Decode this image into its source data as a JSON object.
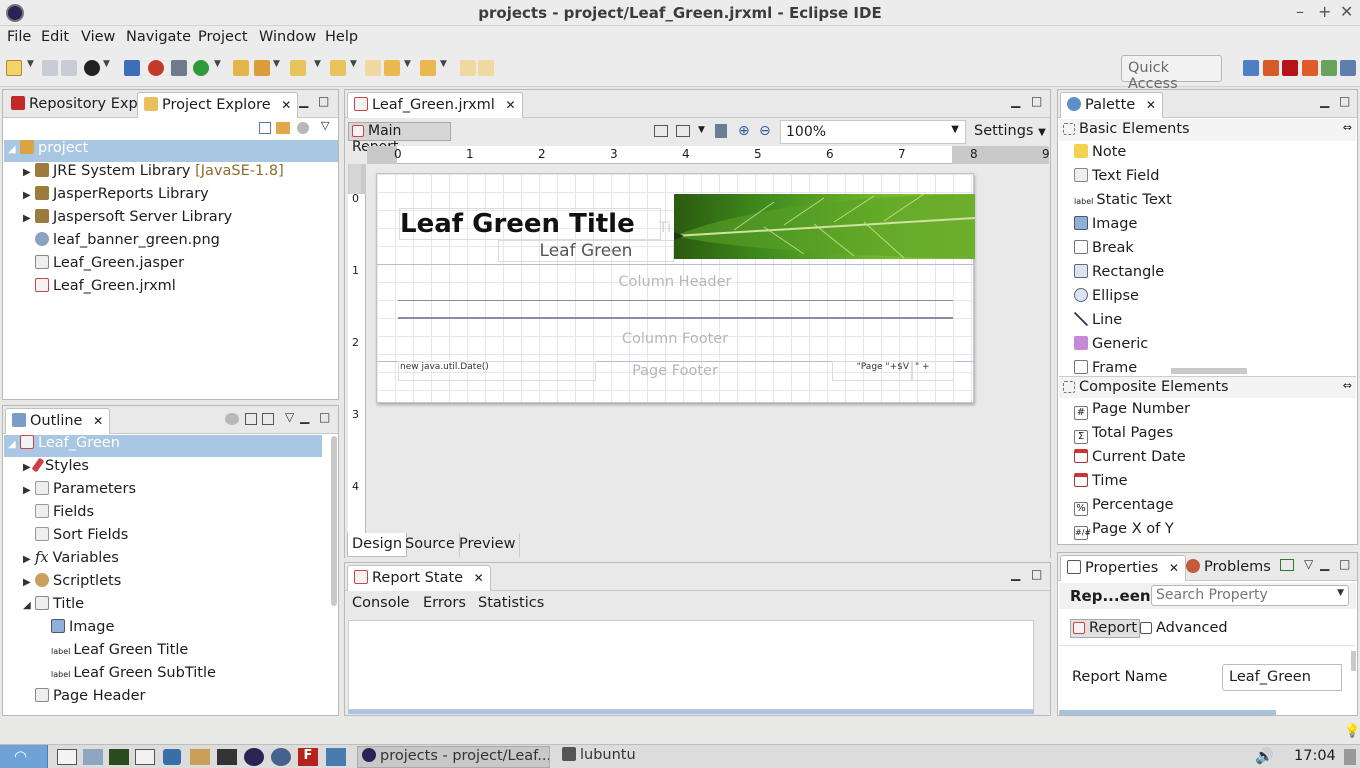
{
  "window": {
    "title": "projects - project/Leaf_Green.jrxml - Eclipse IDE"
  },
  "menu": [
    "File",
    "Edit",
    "View",
    "Navigate",
    "Project",
    "Window",
    "Help"
  ],
  "quick_access": "Quick Access",
  "left_top": {
    "tabs": [
      "Repository Exp",
      "Project Explore"
    ],
    "tree": [
      {
        "label": "project",
        "level": 0,
        "expanded": true
      },
      {
        "label": "JRE System Library",
        "suffix": "[JavaSE-1.8]",
        "level": 1
      },
      {
        "label": "JasperReports Library",
        "level": 1
      },
      {
        "label": "Jaspersoft Server Library",
        "level": 1
      },
      {
        "label": "leaf_banner_green.png",
        "level": 1
      },
      {
        "label": "Leaf_Green.jasper",
        "level": 1
      },
      {
        "label": "Leaf_Green.jrxml",
        "level": 1
      }
    ]
  },
  "outline": {
    "tab": "Outline",
    "items": [
      "Leaf_Green",
      "Styles",
      "Parameters",
      "Fields",
      "Sort Fields",
      "Variables",
      "Scriptlets",
      "Title",
      "Image",
      "Leaf Green Title",
      "Leaf Green SubTitle",
      "Page Header"
    ]
  },
  "editor": {
    "tab": "Leaf_Green.jrxml",
    "main_report": "Main Report",
    "zoom": "100%",
    "settings": "Settings",
    "ruler": [
      "0",
      "1",
      "2",
      "3",
      "4",
      "5",
      "6",
      "7",
      "8",
      "9"
    ],
    "vruler": [
      "0",
      "1",
      "2",
      "3",
      "4"
    ],
    "title_text": "Leaf Green Title",
    "subtitle_text": "Leaf Green",
    "ghost_ti": "Ti",
    "column_header": "Column Header",
    "column_footer": "Column Footer",
    "page_footer": "Page Footer",
    "date_expr": "new java.util.Date()",
    "page_expr": "\"Page \"+$V",
    "page_expr2": "\" +",
    "bottom_tabs": [
      "Design",
      "Source",
      "Preview"
    ]
  },
  "report_state": {
    "tab": "Report State",
    "subtabs": [
      "Console",
      "Errors",
      "Statistics"
    ]
  },
  "palette": {
    "tab": "Palette",
    "basic_header": "Basic Elements",
    "basic": [
      "Note",
      "Text Field",
      "Static Text",
      "Image",
      "Break",
      "Rectangle",
      "Ellipse",
      "Line",
      "Generic",
      "Frame"
    ],
    "composite_header": "Composite Elements",
    "composite": [
      "Page Number",
      "Total Pages",
      "Current Date",
      "Time",
      "Percentage",
      "Page X of Y"
    ]
  },
  "properties": {
    "tabs": [
      "Properties",
      "Problems"
    ],
    "title": "Rep...een",
    "search_placeholder": "Search Property",
    "subtabs": [
      "Report",
      "Advanced"
    ],
    "report_name_label": "Report Name",
    "report_name_value": "Leaf_Green"
  },
  "taskbar": {
    "task": "projects - project/Leaf...",
    "folder": "lubuntu",
    "clock": "17:04"
  }
}
